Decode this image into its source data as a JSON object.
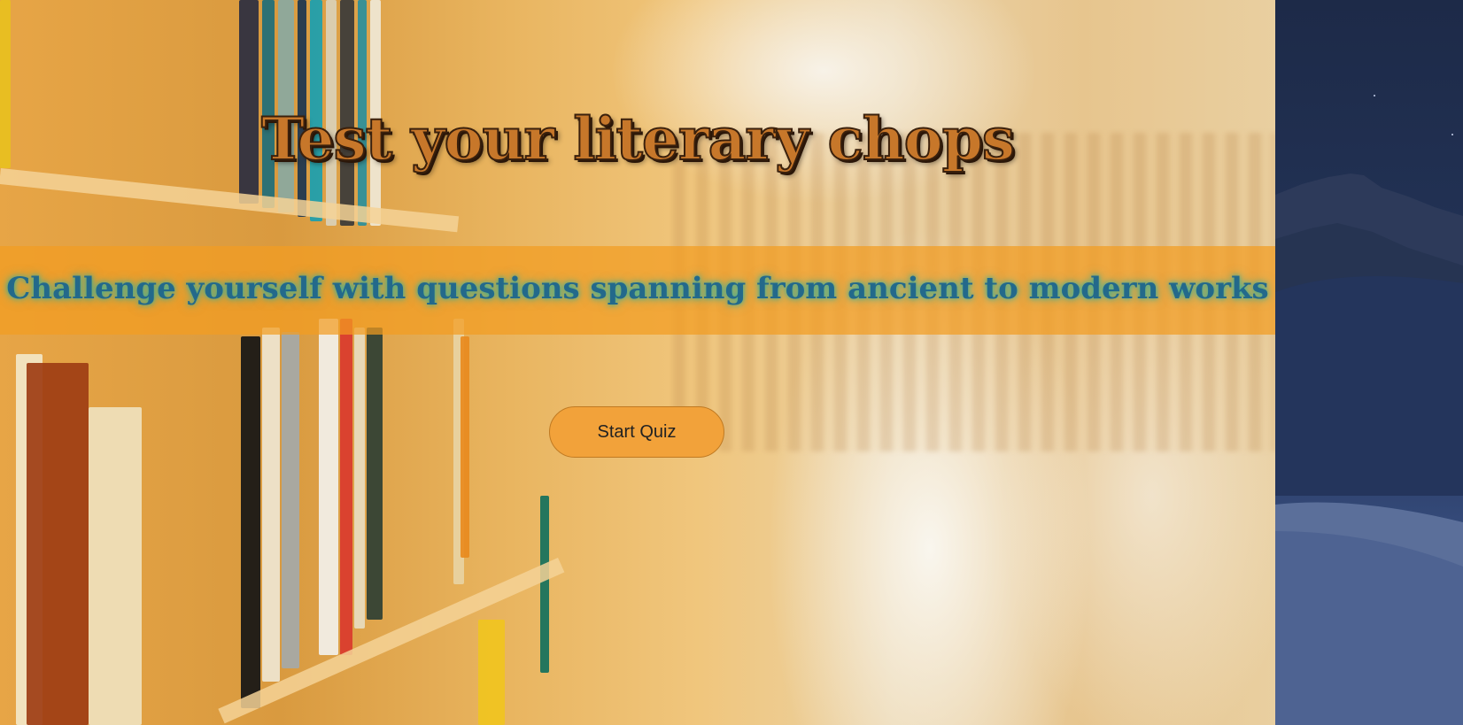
{
  "page": {
    "title": "Test your literary chops",
    "subtitle": "Challenge yourself with questions spanning from ancient to modern works",
    "start_button_label": "Start Quiz"
  },
  "colors": {
    "title_fill": "#c7772a",
    "title_outline": "#3a200c",
    "subtitle_text": "#23698b",
    "subtitle_glow": "#2fb09d",
    "band": "#f39c21",
    "button": "#f2a23a"
  },
  "background": {
    "image": "library-bookshelves-photo",
    "desktop_wallpaper": "night-desert-dunes"
  }
}
